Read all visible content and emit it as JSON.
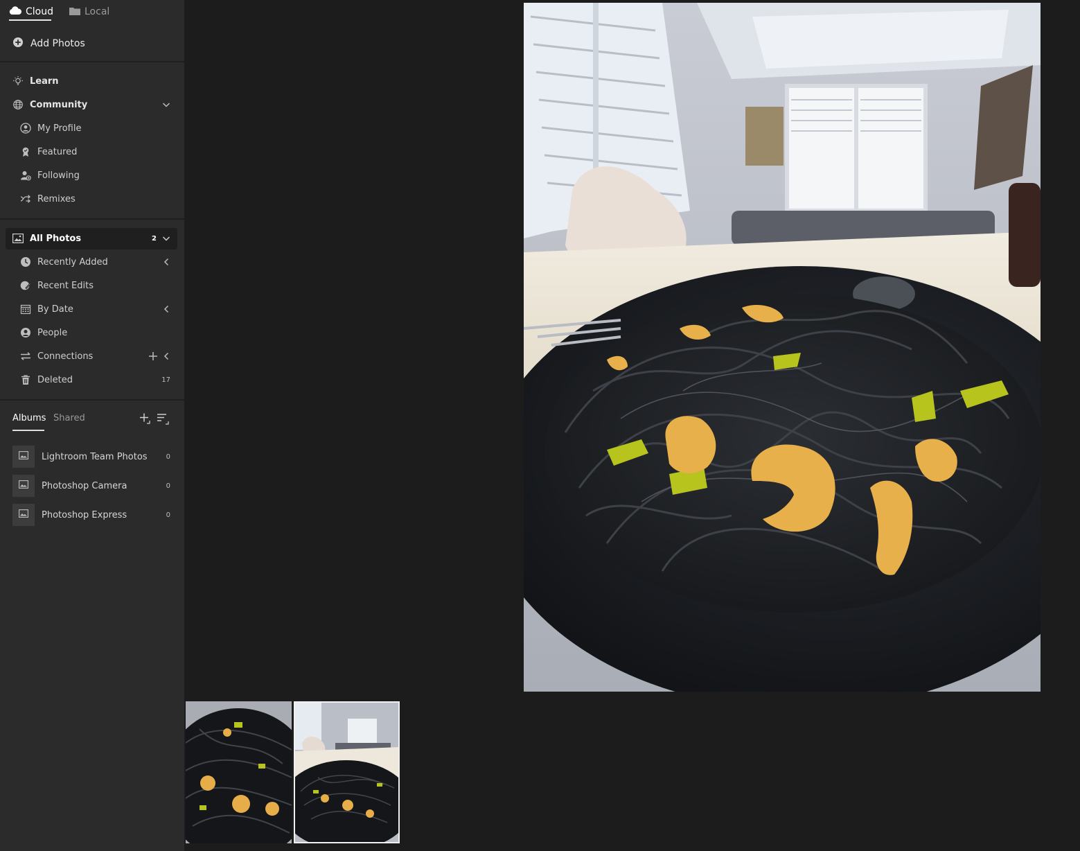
{
  "source_tabs": {
    "cloud": "Cloud",
    "local": "Local"
  },
  "add_photos": "Add Photos",
  "nav": {
    "learn": "Learn",
    "community": {
      "label": "Community",
      "items": [
        "My Profile",
        "Featured",
        "Following",
        "Remixes"
      ]
    }
  },
  "library": {
    "all_photos": {
      "label": "All Photos",
      "count": "2"
    },
    "items": [
      {
        "label": "Recently Added",
        "icon": "clock-icon"
      },
      {
        "label": "Recent Edits",
        "icon": "edit-icon"
      },
      {
        "label": "By Date",
        "icon": "calendar-icon"
      },
      {
        "label": "People",
        "icon": "person-icon"
      },
      {
        "label": "Connections",
        "icon": "connections-icon"
      },
      {
        "label": "Deleted",
        "icon": "trash-icon",
        "count": "17"
      }
    ]
  },
  "albums": {
    "tab_albums": "Albums",
    "tab_shared": "Shared",
    "list": [
      {
        "name": "Lightroom Team Photos",
        "count": "0"
      },
      {
        "name": "Photoshop Camera",
        "count": "0"
      },
      {
        "name": "Photoshop Express",
        "count": "0"
      }
    ]
  },
  "colors": {
    "sidebar_bg": "#2b2b2b",
    "main_bg": "#1c1c1c",
    "selected_bg": "#1f1f1f"
  },
  "filmstrip": {
    "selected_index": 1
  }
}
